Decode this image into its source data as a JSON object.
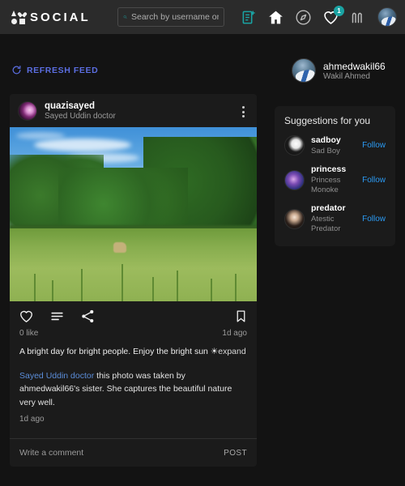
{
  "header": {
    "logo_text": "SOCIAL",
    "search": {
      "placeholder": "Search by username or name",
      "value": "",
      "icon": "search-icon"
    },
    "icons": [
      {
        "name": "new-post-icon",
        "label": "New post",
        "color": "#1aa3a3"
      },
      {
        "name": "home-icon",
        "label": "Home",
        "color": "#ffffff"
      },
      {
        "name": "explore-compass-icon",
        "label": "Explore",
        "color": "#b9b9b9"
      },
      {
        "name": "notifications-heart-icon",
        "label": "Notifications",
        "color": "#ffffff",
        "badge": "1"
      },
      {
        "name": "messages-icon",
        "label": "Messages",
        "color": "#b9b9b9"
      }
    ],
    "badge_count": "1",
    "badge_color": "#1aa3a3"
  },
  "feed": {
    "refresh_label": "REFRESH FEED",
    "refresh_color": "#5b6ee1",
    "post": {
      "username": "quazisayed",
      "fullname": "Sayed Uddin doctor",
      "menu_icon": "more-options-icon",
      "photo_alt": "Green field with trees under a blue sky",
      "actions": [
        {
          "name": "like-icon",
          "label": "Like"
        },
        {
          "name": "comment-icon",
          "label": "Comment"
        },
        {
          "name": "share-icon",
          "label": "Share"
        }
      ],
      "bookmark_icon": "bookmark-icon",
      "likes": "0 like",
      "timestamp": "1d ago",
      "caption": "A bright day for bright people. Enjoy the bright sun ☀",
      "caption_expand": "expand",
      "comment": {
        "author": "Sayed Uddin doctor",
        "text": " this photo was taken by ahmedwakil66's sister. She captures the beautiful nature very well.",
        "timestamp": "1d ago"
      },
      "comment_box": {
        "placeholder": "Write a comment",
        "value": "",
        "post_label": "POST"
      }
    }
  },
  "sidebar": {
    "profile": {
      "username": "ahmedwakil66",
      "fullname": "Wakil Ahmed"
    },
    "suggestions": {
      "title": "Suggestions for you",
      "follow_color": "#2b9bf4",
      "items": [
        {
          "username": "sadboy",
          "fullname": "Sad Boy",
          "follow_label": "Follow",
          "avatar": "sa-sadboy"
        },
        {
          "username": "princess",
          "fullname": "Princess Monoke",
          "follow_label": "Follow",
          "avatar": "sa-princess"
        },
        {
          "username": "predator",
          "fullname": "Atestic Predator",
          "follow_label": "Follow",
          "avatar": "sa-predator"
        }
      ]
    }
  },
  "theme": {
    "page_bg": "#131313",
    "header_bg": "#2b2b2b",
    "card_bg": "#1b1b1b",
    "accent_teal": "#1aa3a3",
    "link_blue": "#2b9bf4"
  }
}
